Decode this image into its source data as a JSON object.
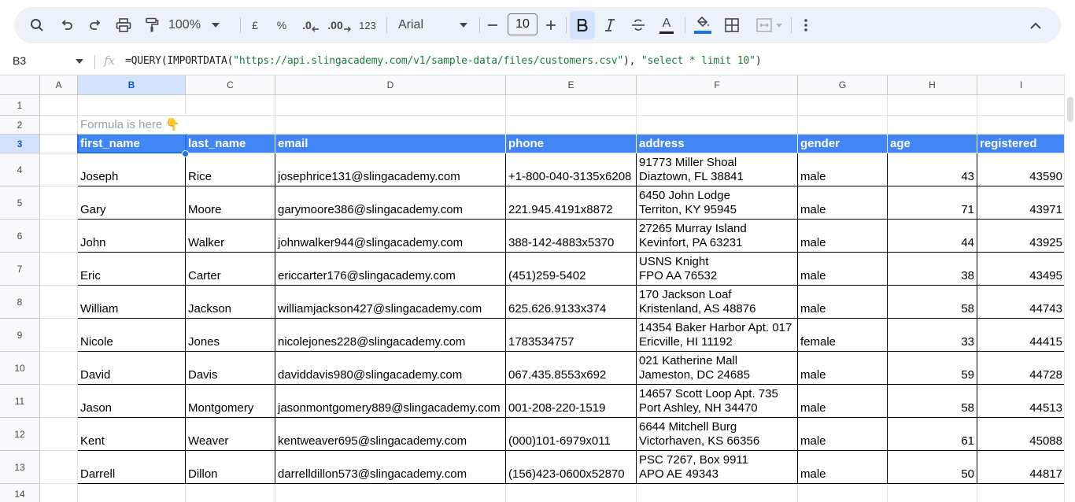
{
  "toolbar": {
    "zoom": "100%",
    "currency": "£",
    "percent": "%",
    "decrease_decimal": ".0",
    "increase_decimal": ".00",
    "more_formats": "123",
    "font": "Arial",
    "font_size": "10",
    "text_color": "A",
    "fill_color_accent": "#1a73e8"
  },
  "formula_bar": {
    "name_box": "B3",
    "fx": "fx",
    "formula_prefix": "=QUERY(IMPORTDATA(",
    "formula_url": "\"https://api.slingacademy.com/v1/sample-data/files/customers.csv\"",
    "formula_mid": "), ",
    "formula_query": "\"select * limit 10\"",
    "formula_suffix": ")"
  },
  "sheet": {
    "columns": [
      "A",
      "B",
      "C",
      "D",
      "E",
      "F",
      "G",
      "H",
      "I"
    ],
    "selected_column": "B",
    "rows": [
      "1",
      "2",
      "3",
      "4",
      "5",
      "6",
      "7",
      "8",
      "9",
      "10",
      "11",
      "12",
      "13",
      "14"
    ],
    "selected_row": "3",
    "note": "Formula is here 👇",
    "headers": [
      "first_name",
      "last_name",
      "email",
      "phone",
      "address",
      "gender",
      "age",
      "registered"
    ],
    "records": [
      [
        "Joseph",
        "Rice",
        "josephrice131@slingacademy.com",
        "+1-800-040-3135x6208",
        "91773 Miller Shoal",
        "Diaztown, FL 38841",
        "male",
        "43",
        "43590"
      ],
      [
        "Gary",
        "Moore",
        "garymoore386@slingacademy.com",
        "221.945.4191x8872",
        "6450 John Lodge",
        "Territon, KY 95945",
        "male",
        "71",
        "43971"
      ],
      [
        "John",
        "Walker",
        "johnwalker944@slingacademy.com",
        "388-142-4883x5370",
        "27265 Murray Island",
        "Kevinfort, PA 63231",
        "male",
        "44",
        "43925"
      ],
      [
        "Eric",
        "Carter",
        "ericcarter176@slingacademy.com",
        "(451)259-5402",
        "USNS Knight",
        "FPO AA 76532",
        "male",
        "38",
        "43495"
      ],
      [
        "William",
        "Jackson",
        "williamjackson427@slingacademy.com",
        "625.626.9133x374",
        "170 Jackson Loaf",
        "Kristenland, AS 48876",
        "male",
        "58",
        "44743"
      ],
      [
        "Nicole",
        "Jones",
        "nicolejones228@slingacademy.com",
        "1783534757",
        "14354 Baker Harbor Apt. 017",
        "Ericville, HI 11192",
        "female",
        "33",
        "44415"
      ],
      [
        "David",
        "Davis",
        "daviddavis980@slingacademy.com",
        "067.435.8553x692",
        "021 Katherine Mall",
        "Jameston, DC 24685",
        "male",
        "59",
        "44728"
      ],
      [
        "Jason",
        "Montgomery",
        "jasonmontgomery889@slingacademy.com",
        "001-208-220-1519",
        "14657 Scott Loop Apt. 735",
        "Port Ashley, NH 34470",
        "male",
        "58",
        "44513"
      ],
      [
        "Kent",
        "Weaver",
        "kentweaver695@slingacademy.com",
        "(000)101-6979x011",
        "6644 Mitchell Burg",
        "Victorhaven, KS 66356",
        "male",
        "61",
        "45088"
      ],
      [
        "Darrell",
        "Dillon",
        "darrelldillon573@slingacademy.com",
        "(156)423-0600x52870",
        "PSC 7267, Box 9911",
        "APO AE 49343",
        "male",
        "50",
        "44817"
      ]
    ]
  }
}
